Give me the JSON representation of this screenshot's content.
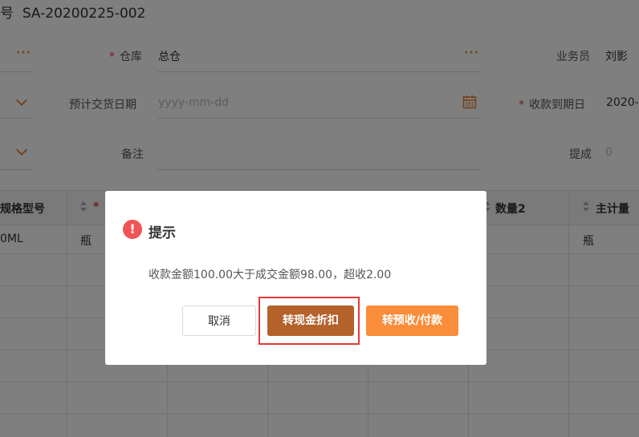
{
  "header": {
    "doc_number_label": "号",
    "doc_number": "SA-20200225-002"
  },
  "form": {
    "warehouse": {
      "label": "仓库",
      "value": "总仓"
    },
    "salesperson": {
      "label": "业务员",
      "value": "刘影"
    },
    "expected_delivery_date": {
      "label": "预计交货日期",
      "placeholder": "yyyy-mm-dd"
    },
    "collection_due_date": {
      "label": "收款到期日",
      "value": "2020-"
    },
    "remarks": {
      "label": "备注",
      "value": ""
    },
    "commission": {
      "label": "提成",
      "value": "0"
    }
  },
  "table": {
    "headers": [
      "规格型号",
      "*",
      "数量2",
      "主计量"
    ],
    "row1": {
      "spec": "0ML",
      "unit": "瓶",
      "main_unit": "瓶"
    }
  },
  "dialog": {
    "title": "提示",
    "icon": "exclamation-icon",
    "message": "收款金额100.00大于成交金额98.00，超收2.00",
    "buttons": {
      "cancel": "取消",
      "discount": "转现金折扣",
      "prepay": "转预收/付款"
    }
  },
  "colors": {
    "accent": "#e8873a",
    "primary_button": "#b4612a",
    "secondary_button": "#f98d3a",
    "danger": "#f05454",
    "highlight_border": "#e53935"
  }
}
